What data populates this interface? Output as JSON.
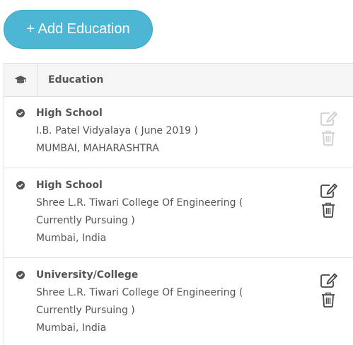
{
  "add_button": {
    "label": "+ Add Education"
  },
  "header": {
    "title": "Education",
    "icon": "graduation-cap-icon"
  },
  "entries": [
    {
      "level": "High School",
      "institution": "I.B. Patel Vidyalaya ( June 2019 )",
      "location": "MUMBAI, MAHARASHTRA",
      "actions_enabled": false
    },
    {
      "level": "High School",
      "institution": "Shree L.R. Tiwari College Of Engineering ( Currently Pursuing )",
      "location": "Mumbai, India",
      "actions_enabled": true
    },
    {
      "level": "University/College",
      "institution": "Shree L.R. Tiwari College Of Engineering ( Currently Pursuing )",
      "location": "Mumbai, India",
      "actions_enabled": true
    }
  ],
  "colors": {
    "accent": "#4db6d5",
    "icon_enabled": "#444444",
    "icon_disabled": "#cfcfcf"
  }
}
